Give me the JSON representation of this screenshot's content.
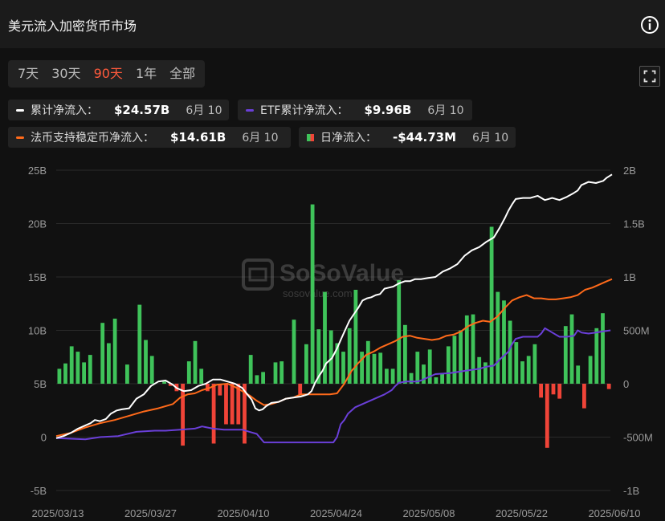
{
  "header": {
    "title": "美元流入加密货币市场"
  },
  "tabs": [
    "7天",
    "30天",
    "90天",
    "1年",
    "全部"
  ],
  "active_tab": 2,
  "legend": [
    {
      "label": "累计净流入：",
      "value": "$24.57B",
      "date": "6月 10",
      "color": "#ffffff",
      "marker": "line"
    },
    {
      "label": "ETF累计净流入：",
      "value": "$9.96B",
      "date": "6月 10",
      "color": "#6a3fd8",
      "marker": "line"
    },
    {
      "label": "法币支持稳定币净流入：",
      "value": "$14.61B",
      "date": "6月 10",
      "color": "#ff6a1a",
      "marker": "line"
    },
    {
      "label": "日净流入：",
      "value": "-$44.73M",
      "date": "6月 10",
      "color": "#f04438",
      "marker": "bar"
    }
  ],
  "watermark": {
    "name": "SoSoValue",
    "site": "sosovalue.com"
  },
  "chart_data": {
    "type": "bar",
    "x_labels": [
      "2025/03/13",
      "2025/03/27",
      "2025/04/10",
      "2025/04/24",
      "2025/05/08",
      "2025/05/22",
      "2025/06/10"
    ],
    "left_axis": {
      "ticks": [
        "25B",
        "20B",
        "15B",
        "10B",
        "5B",
        "0",
        "-5B"
      ],
      "ylim": [
        -5,
        25
      ]
    },
    "right_axis": {
      "ticks": [
        "2B",
        "1.5B",
        "1B",
        "500M",
        "0",
        "-500M",
        "-1B"
      ],
      "ylim": [
        -1,
        2
      ]
    },
    "colors": {
      "positive": "#3fc35a",
      "negative": "#f04438",
      "cumulative": "#ffffff",
      "etf": "#6a3fd8",
      "stablecoin": "#ff6a1a"
    },
    "series": [
      {
        "name": "日净流入",
        "axis": "right",
        "values": [
          0.14,
          0.19,
          0.35,
          0.3,
          0.2,
          0.27,
          0,
          0.57,
          0.38,
          0.61,
          0,
          0.18,
          0,
          0.74,
          0.41,
          0.26,
          0,
          0.02,
          -0.02,
          -0.07,
          -0.58,
          0.21,
          0.4,
          0.14,
          -0.07,
          -0.56,
          -0.11,
          -0.38,
          -0.38,
          -0.38,
          -0.56,
          0.27,
          0.08,
          0.11,
          0,
          0.2,
          0.21,
          0,
          0.6,
          -0.1,
          0.37,
          1.68,
          0.51,
          0.86,
          0.5,
          0.38,
          0.3,
          0.52,
          0.88,
          0.3,
          0.4,
          0.28,
          0.29,
          0.14,
          0.14,
          0.97,
          0.55,
          0.1,
          0.3,
          0.18,
          0.32,
          0.06,
          0.1,
          0.35,
          0.45,
          0.5,
          0.64,
          0.65,
          0.25,
          0.2,
          1.47,
          0.86,
          0.78,
          0.59,
          0.39,
          0.21,
          0.26,
          0.37,
          -0.13,
          -0.6,
          -0.1,
          -0.14,
          0.54,
          0.65,
          0.17,
          -0.23,
          0.26,
          0.52,
          0.66,
          -0.05
        ]
      },
      {
        "name": "累计净流入",
        "axis": "left",
        "x": [
          0,
          10,
          20,
          30,
          40,
          47,
          53,
          60,
          68,
          75,
          83,
          90,
          100,
          110,
          120,
          130,
          140,
          150,
          160,
          165,
          175,
          185,
          195,
          205,
          215,
          225,
          235,
          245,
          255,
          262,
          268,
          273,
          278,
          283,
          288,
          295,
          305,
          315,
          325,
          335,
          345,
          350,
          355,
          360,
          365,
          370,
          378,
          385,
          390,
          396,
          402,
          408,
          414,
          420,
          426,
          432,
          438,
          444,
          450,
          456,
          462,
          470,
          478,
          485,
          492,
          500,
          510,
          520,
          530,
          540,
          550,
          560,
          570,
          580,
          590,
          600,
          608,
          615,
          620,
          625,
          630,
          640,
          650,
          660,
          670,
          675,
          680,
          690,
          700,
          708,
          715,
          720,
          730,
          740,
          750,
          755,
          762
        ],
        "values": [
          -0.1,
          0.1,
          0.4,
          0.8,
          1.1,
          1.3,
          1.6,
          1.5,
          1.7,
          2.2,
          2.5,
          2.6,
          2.7,
          3.6,
          4.0,
          4.8,
          5.2,
          5.3,
          4.9,
          4.6,
          4.3,
          4.4,
          4.8,
          5.0,
          5.4,
          5.4,
          5.2,
          5.0,
          4.6,
          4.0,
          3.5,
          2.7,
          2.5,
          2.6,
          2.9,
          3.2,
          3.3,
          3.6,
          3.7,
          3.8,
          4.0,
          4.3,
          5.1,
          5.7,
          6.2,
          6.9,
          7.4,
          8.3,
          9.1,
          10.0,
          10.9,
          11.5,
          12.1,
          12.8,
          13.0,
          13.1,
          13.3,
          13.4,
          13.9,
          14.0,
          14.1,
          14.4,
          14.6,
          14.6,
          14.8,
          14.8,
          14.9,
          15.0,
          15.5,
          15.8,
          16.2,
          17.0,
          17.5,
          17.8,
          18.3,
          18.7,
          19.6,
          20.5,
          21.2,
          21.8,
          22.3,
          22.4,
          22.4,
          22.6,
          22.2,
          22.3,
          22.4,
          22.2,
          22.5,
          22.8,
          23.1,
          23.6,
          23.9,
          23.8,
          24.0,
          24.3,
          24.6
        ]
      },
      {
        "name": "ETF累计净流入",
        "axis": "right",
        "x": [
          0,
          40,
          60,
          85,
          110,
          135,
          150,
          170,
          190,
          200,
          215,
          230,
          245,
          255,
          265,
          275,
          285,
          295,
          305,
          315,
          335,
          355,
          370,
          380,
          385,
          390,
          395,
          400,
          410,
          420,
          430,
          440,
          450,
          460,
          465,
          470,
          480,
          490,
          495,
          500,
          510,
          520,
          540,
          560,
          580,
          590,
          600,
          610,
          620,
          625,
          630,
          640,
          650,
          660,
          665,
          670,
          680,
          690,
          700,
          710,
          715,
          720,
          730,
          740,
          750,
          760
        ],
        "values": [
          -0.51,
          -0.52,
          -0.5,
          -0.49,
          -0.45,
          -0.44,
          -0.44,
          -0.43,
          -0.42,
          -0.4,
          -0.42,
          -0.43,
          -0.43,
          -0.43,
          -0.45,
          -0.47,
          -0.55,
          -0.55,
          -0.55,
          -0.55,
          -0.55,
          -0.55,
          -0.55,
          -0.55,
          -0.5,
          -0.38,
          -0.34,
          -0.28,
          -0.22,
          -0.19,
          -0.16,
          -0.13,
          -0.1,
          -0.06,
          -0.02,
          0.01,
          0.02,
          0.02,
          0.02,
          0.03,
          0.06,
          0.09,
          0.1,
          0.12,
          0.14,
          0.16,
          0.17,
          0.24,
          0.3,
          0.37,
          0.42,
          0.44,
          0.44,
          0.44,
          0.47,
          0.52,
          0.48,
          0.44,
          0.44,
          0.45,
          0.5,
          0.48,
          0.47,
          0.48,
          0.49,
          0.5
        ]
      },
      {
        "name": "法币支持稳定币净流入",
        "axis": "left",
        "x": [
          0,
          20,
          40,
          60,
          80,
          100,
          120,
          140,
          160,
          170,
          180,
          190,
          200,
          210,
          220,
          235,
          245,
          255,
          265,
          275,
          285,
          295,
          305,
          315,
          325,
          335,
          345,
          355,
          365,
          375,
          385,
          395,
          405,
          415,
          425,
          435,
          445,
          455,
          465,
          475,
          485,
          495,
          505,
          515,
          525,
          535,
          545,
          555,
          565,
          575,
          585,
          595,
          605,
          615,
          625,
          635,
          645,
          655,
          665,
          675,
          685,
          695,
          705,
          715,
          725,
          735,
          745,
          755,
          762
        ],
        "values": [
          0.1,
          0.4,
          0.9,
          1.3,
          1.6,
          2.0,
          2.4,
          2.7,
          3.1,
          3.7,
          4.0,
          4.1,
          4.4,
          4.6,
          4.9,
          5.0,
          4.7,
          4.3,
          3.9,
          3.4,
          3.0,
          3.1,
          3.3,
          3.6,
          3.7,
          4.0,
          4.0,
          4.0,
          4.0,
          4.0,
          4.1,
          5.0,
          6.2,
          7.0,
          7.7,
          8.0,
          8.4,
          8.7,
          9.0,
          9.4,
          9.5,
          9.3,
          9.2,
          9.1,
          9.2,
          9.5,
          9.6,
          9.9,
          10.4,
          10.7,
          10.9,
          10.8,
          11.3,
          12.1,
          12.8,
          13.1,
          13.3,
          13.0,
          13.0,
          12.9,
          12.9,
          13.0,
          13.1,
          13.3,
          13.8,
          14.0,
          14.3,
          14.6,
          14.8
        ]
      }
    ]
  }
}
